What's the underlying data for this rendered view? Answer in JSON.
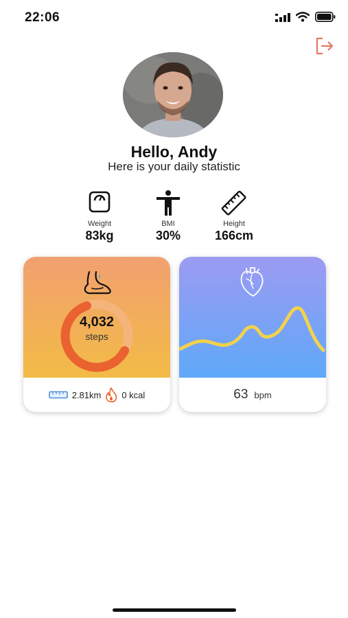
{
  "status_bar": {
    "time": "22:06"
  },
  "profile": {
    "greeting": "Hello, Andy",
    "subtitle": "Here is your daily statistic"
  },
  "metrics": [
    {
      "label": "Weight",
      "value": "83kg",
      "icon": "weight-scale-icon"
    },
    {
      "label": "BMI",
      "value": "30%",
      "icon": "person-icon"
    },
    {
      "label": "Height",
      "value": "166cm",
      "icon": "ruler-icon"
    }
  ],
  "steps_card": {
    "steps": "4,032",
    "steps_unit": "steps",
    "distance": "2.81km",
    "calories": "0 kcal",
    "progress": 0.62
  },
  "heart_card": {
    "bpm": "63",
    "bpm_unit": "bpm"
  },
  "colors": {
    "logout": "#e5775f",
    "steps_gradient_top": "#f1a070",
    "steps_gradient_bottom": "#f3bb46",
    "ring_track": "#f4b47a",
    "ring_fill": "#e9622f",
    "heart_gradient_top": "#9c9bf2",
    "heart_gradient_bottom": "#5fa8f8",
    "heart_line": "#f2d24c"
  }
}
